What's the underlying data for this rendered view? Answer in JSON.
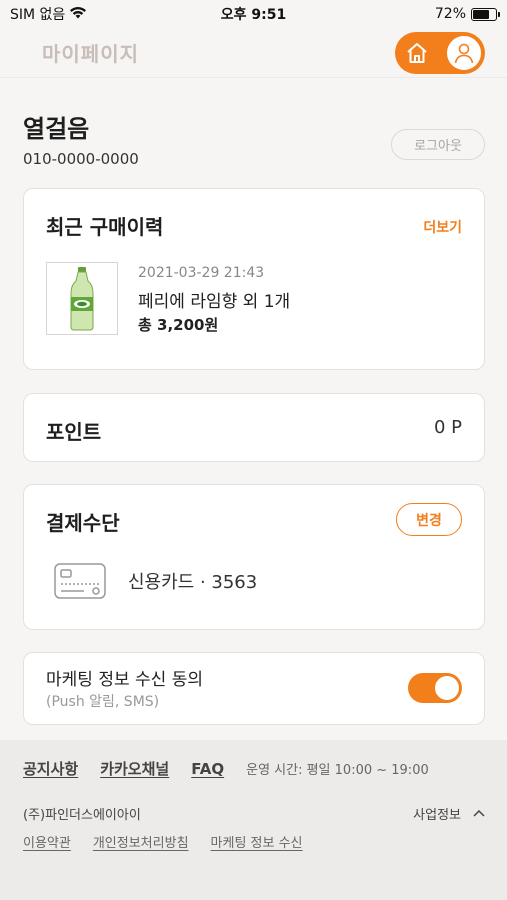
{
  "status_bar": {
    "carrier": "SIM 없음",
    "time": "오후 9:51",
    "battery": "72%",
    "battery_level": 0.72
  },
  "header": {
    "title": "마이페이지",
    "home_icon": "home-icon",
    "user_icon": "user-icon"
  },
  "profile": {
    "name": "열걸음",
    "phone": "010-0000-0000",
    "logout_label": "로그아웃"
  },
  "recent_purchase": {
    "title": "최근 구매이력",
    "more_label": "더보기",
    "date": "2021-03-29 21:43",
    "product": "페리에 라임향 외 1개",
    "total": "총 3,200원"
  },
  "points": {
    "title": "포인트",
    "value": "0 P"
  },
  "payment": {
    "title": "결제수단",
    "change_label": "변경",
    "card_text": "신용카드 · 3563"
  },
  "marketing": {
    "title": "마케팅 정보 수신 동의",
    "subtitle": "(Push 알림, SMS)",
    "enabled": true
  },
  "footer": {
    "links": [
      "공지사항",
      "카카오채널",
      "FAQ"
    ],
    "hours": "운영 시간: 평일 10:00 ~ 19:00",
    "company": "(주)파인더스에이아이",
    "business_info_label": "사업정보",
    "terms": [
      "이용약관",
      "개인정보처리방침",
      "마케팅 정보 수신"
    ]
  },
  "colors": {
    "accent": "#f27f1c",
    "background": "#f6f5f4",
    "card": "#ffffff",
    "footer": "#ecebea"
  }
}
